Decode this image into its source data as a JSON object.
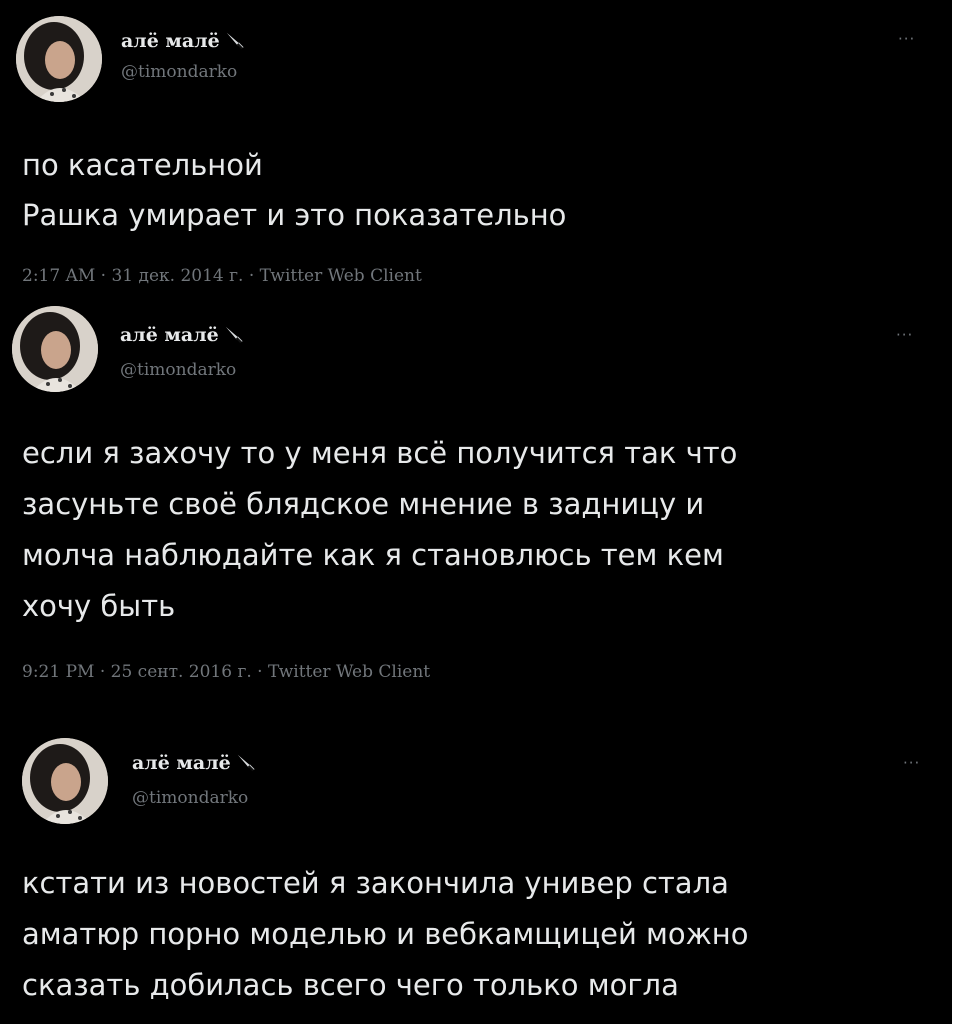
{
  "tweets": [
    {
      "display_name": "алё малё",
      "handle": "@timondarko",
      "more": "···",
      "text": "по касательной\nРашка умирает и это показательно",
      "meta": "2:17 AM · 31 дек. 2014 г. · Twitter Web Client"
    },
    {
      "display_name": "алё малё",
      "handle": "@timondarko",
      "more": "···",
      "text": "если я захочу то у меня всё получится так что\nзасуньте своё блядское мнение в задницу и\nмолча наблюдайте как я становлюсь тем кем\nхочу быть",
      "meta": "9:21 PM · 25 сент. 2016 г. · Twitter Web Client"
    },
    {
      "display_name": "алё малё",
      "handle": "@timondarko",
      "more": "···",
      "text": "кстати из новостей я закончила универ стала\nаматюр порно моделью и вебкамщицей можно\nсказать добилась всего чего только могла"
    }
  ],
  "icons": {
    "display_name_emoji": "knife-icon",
    "overflow_menu": "more-icon"
  },
  "colors": {
    "background": "#000000",
    "primary_text": "#e7e9ea",
    "secondary_text": "#71767b"
  }
}
